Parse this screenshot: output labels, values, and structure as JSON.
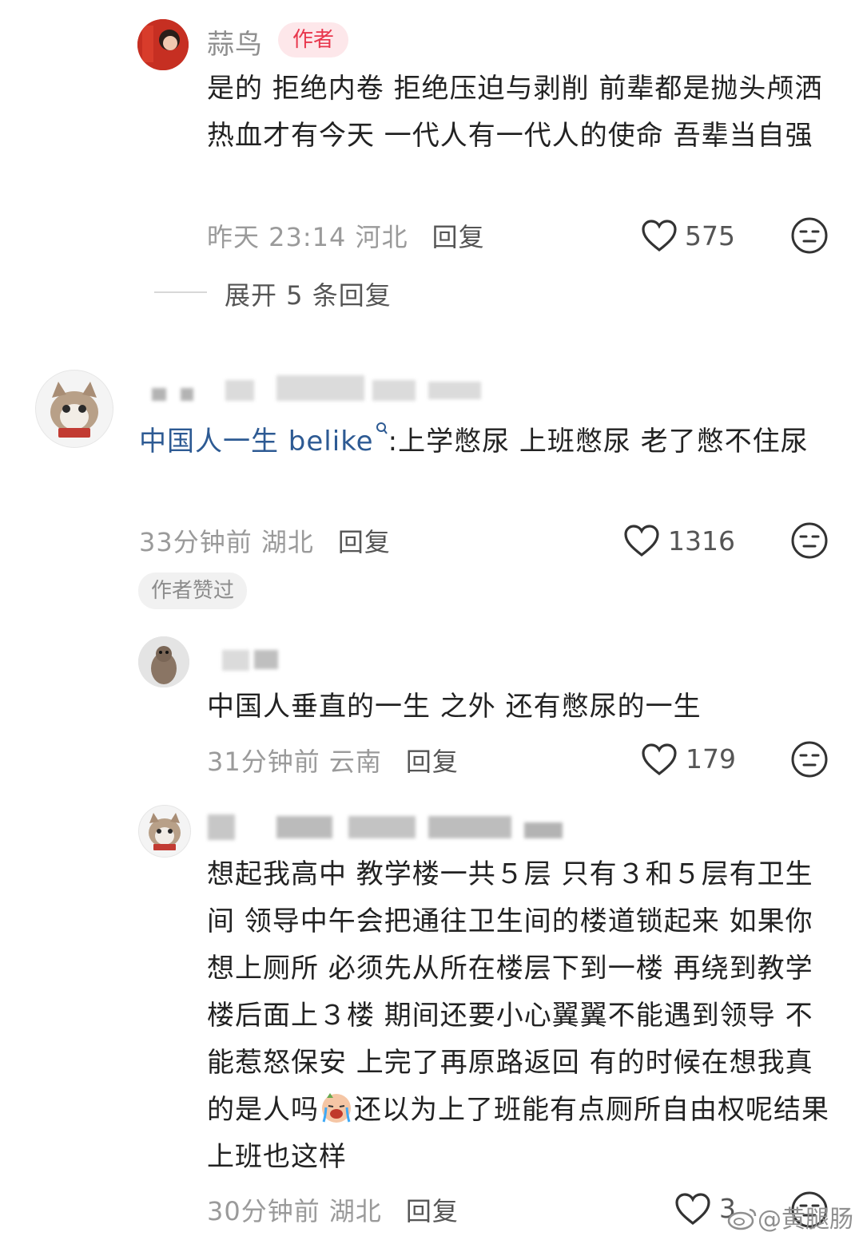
{
  "comments": [
    {
      "name": "蒜鸟",
      "badge": "作者",
      "content": "是的 拒绝内卷 拒绝压迫与剥削 前辈都是抛头颅洒热血才有今天 一代人有一代人的使命 吾辈当自强",
      "time": "昨天 23:14 河北",
      "reply_label": "回复",
      "likes": "575",
      "expand_label": "展开 5 条回复"
    },
    {
      "link_text": "中国人一生 belike",
      "content_rest": ":上学憋尿 上班憋尿 老了憋不住尿",
      "time": "33分钟前 湖北",
      "reply_label": "回复",
      "likes": "1316",
      "tag": "作者赞过"
    },
    {
      "content": "中国人垂直的一生 之外 还有憋尿的一生",
      "time": "31分钟前 云南",
      "reply_label": "回复",
      "likes": "179"
    },
    {
      "content_before_emoji": "想起我高中 教学楼一共５层 只有３和５层有卫生间 领导中午会把通往卫生间的楼道锁起来 如果你想上厕所 必须先从所在楼层下到一楼 再绕到教学楼后面上３楼 期间还要小心翼翼不能遇到领导 不能惹怒保安 上完了再原路返回 有的时候在想我真的是人吗",
      "content_after_emoji": "还以为上了班能有点厕所自由权呢结果上班也这样",
      "time": "30分钟前 湖北",
      "reply_label": "回复",
      "likes": "3"
    }
  ],
  "watermark": "@黄腿肠",
  "icons": {
    "like": "heart-outline-icon",
    "dislike": "neutral-face-icon",
    "search": "search-icon",
    "emoji": "crying-emoji-icon",
    "watermark": "weibo-logo-icon"
  },
  "colors": {
    "author_badge_text": "#e8364c",
    "author_badge_bg": "#fde7ea",
    "link": "#2d5a93",
    "meta": "#9a9a9a"
  }
}
